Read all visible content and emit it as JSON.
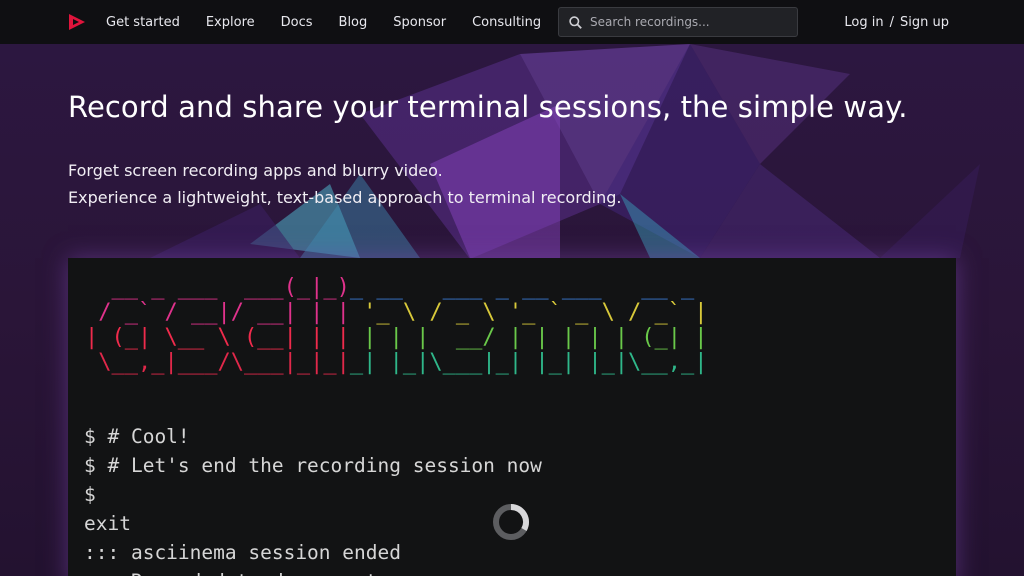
{
  "nav": {
    "logo_icon": "asciinema-play-logo",
    "items": [
      {
        "label": "Get started"
      },
      {
        "label": "Explore"
      },
      {
        "label": "Docs"
      },
      {
        "label": "Blog"
      },
      {
        "label": "Sponsor"
      },
      {
        "label": "Consulting"
      }
    ],
    "search_placeholder": "Search recordings...",
    "login_label": "Log in",
    "separator": "/",
    "signup_label": "Sign up"
  },
  "hero": {
    "headline": "Record and share your terminal sessions, the simple way.",
    "sub_line1": "Forget screen recording apps and blurry video.",
    "sub_line2": "Experience a lightweight, text-based approach to terminal recording."
  },
  "terminal": {
    "ascii_art": [
      [
        [
          "  __ _ ___  ___(_|_)",
          "#e0328c"
        ],
        [
          "_ __   ___ _ __ ___   __ _ ",
          "#3a7bd5"
        ]
      ],
      [
        [
          " / _` / __|/ __| | |",
          "#e0328c"
        ],
        [
          " '_ \\ / _ \\ '_ ` _ \\ / _` |",
          "#d8c93a"
        ]
      ],
      [
        [
          "| (_| \\__ \\ (__| | |",
          "#ef2b4c"
        ],
        [
          " | | |  __/ | | | | | (_| |",
          "#6ac94a"
        ]
      ],
      [
        [
          " \\__,_|___/\\___|_|_|",
          "#e0284a"
        ],
        [
          "_| |_|\\___|_| |_| |_|\\__,_|",
          "#2fb78a"
        ]
      ]
    ],
    "lines": [
      "$ # Cool!",
      "$ # Let's end the recording session now",
      "$",
      "exit",
      "::: asciinema session ended",
      "::: Recorded to demo.cast"
    ],
    "loading_icon": "loading-spinner-icon"
  },
  "colors": {
    "brand_red": "#e0143c",
    "topbar": "#0f0f12",
    "hero_bg": "#2a1538",
    "terminal_bg": "#121314"
  }
}
